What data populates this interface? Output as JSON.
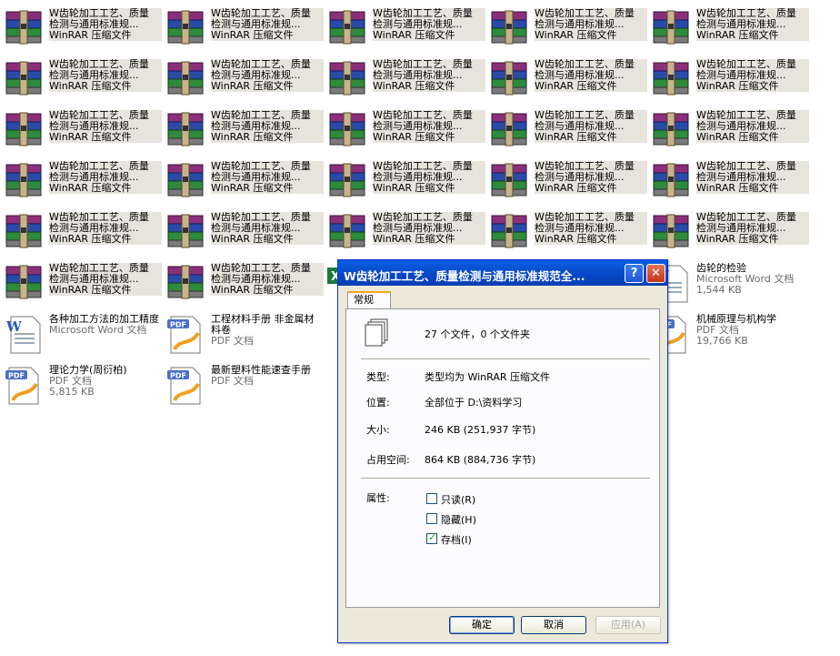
{
  "rar_file": {
    "name": "W齿轮加工工艺、质量",
    "name2": "检测与通用标准规...",
    "type": "WinRAR 压缩文件"
  },
  "files": [
    {
      "name": "齿轮的检验",
      "type": "Microsoft Word 文档",
      "size": "1,544 KB"
    },
    {
      "name": "各种加工方法的加工精度",
      "type": "Microsoft Word 文档",
      "size": ""
    },
    {
      "name": "工程材料手册  非金属材料卷",
      "type": "PDF 文档",
      "size": ""
    },
    {
      "name": "机械原理与机构学",
      "type": "PDF 文档",
      "size": "19,766 KB"
    },
    {
      "name": "理论力学(周衍柏)",
      "type": "PDF 文档",
      "size": "5,815 KB"
    },
    {
      "name": "最新塑料性能速查手册",
      "type": "PDF 文档",
      "size": ""
    }
  ],
  "dialog": {
    "title": "W齿轮加工工艺、质量检测与通用标准规范全...",
    "help_icon": "?",
    "close_icon": "✕",
    "tab": "常规",
    "summary": "27 个文件，0 个文件夹",
    "type_label": "类型:",
    "type_value": "类型均为 WinRAR 压缩文件",
    "location_label": "位置:",
    "location_value": "全部位于 D:\\资料学习",
    "size_label": "大小:",
    "size_value": "246 KB (251,937 字节)",
    "disk_label": "占用空间:",
    "disk_value": "864 KB (884,736 字节)",
    "attr_label": "属性:",
    "readonly": "只读(R)",
    "hidden": "隐藏(H)",
    "archive": "存档(I)",
    "archive_checked": true,
    "ok": "确定",
    "cancel": "取消",
    "apply": "应用(A)"
  }
}
